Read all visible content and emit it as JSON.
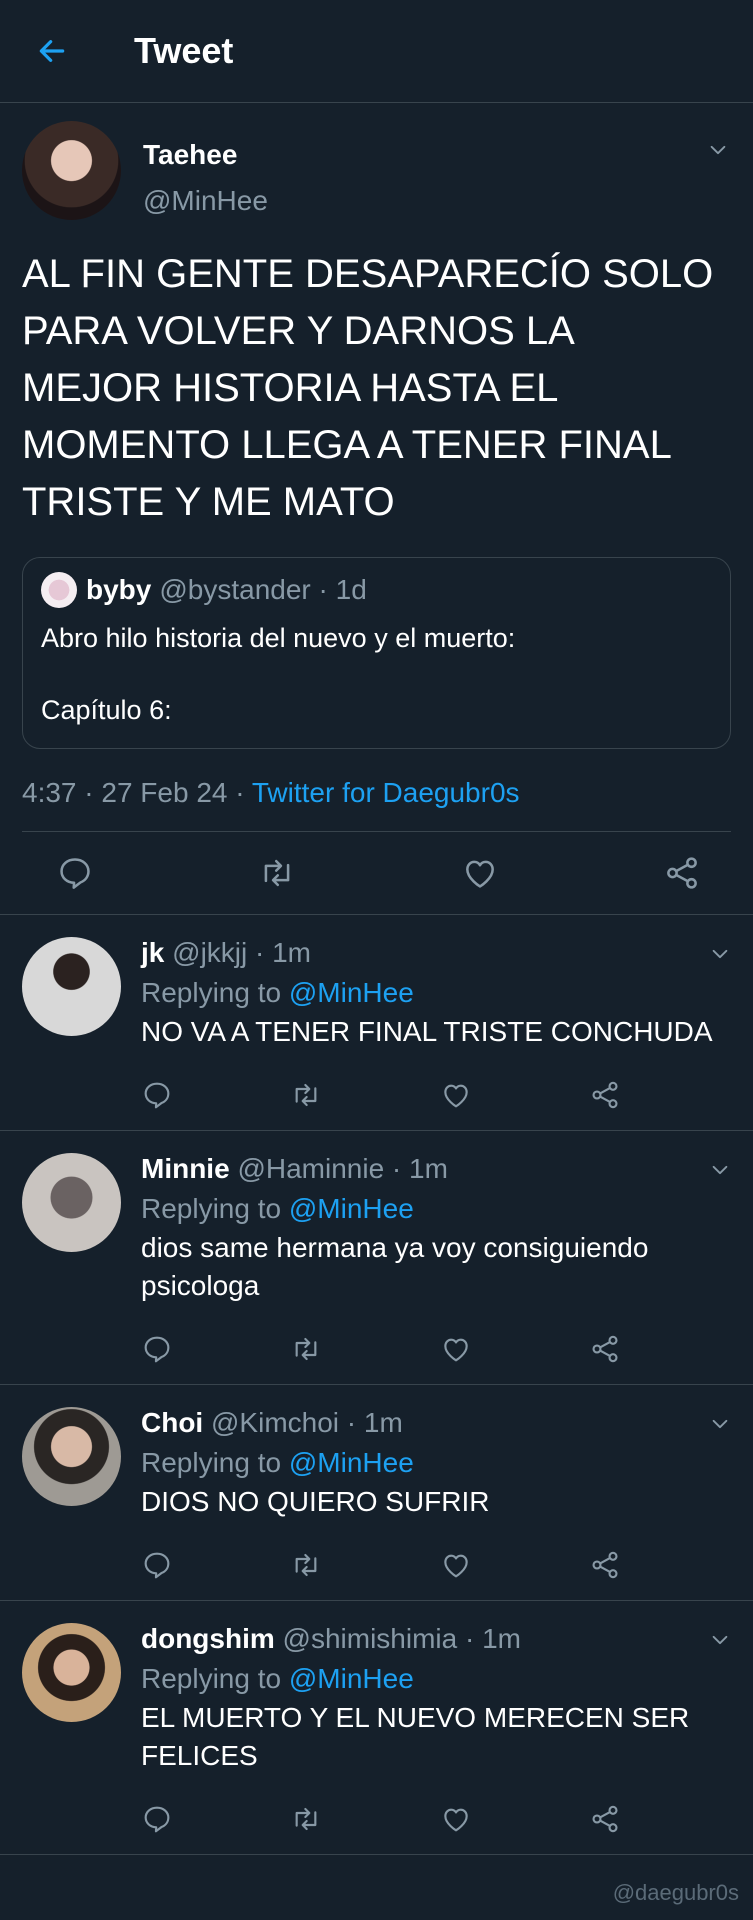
{
  "header": {
    "title": "Tweet"
  },
  "main_tweet": {
    "author_name": "Taehee",
    "author_handle": "@MinHee",
    "text": "AL FIN GENTE DESAPARECÍO SOLO PARA VOLVER Y DARNOS LA MEJOR HISTORIA HASTA EL MOMENTO LLEGA A TENER FINAL TRISTE Y ME MATO",
    "quote": {
      "name": "byby",
      "handle_time": "@bystander · 1d",
      "text": "Abro hilo historia del nuevo y el muerto:\n\nCapítulo 6:"
    },
    "meta_time": "4:37 · 27 Feb 24 · ",
    "meta_source": "Twitter for Daegubr0s"
  },
  "replies": [
    {
      "name": "jk",
      "handle_time": "@jkkjj · 1m",
      "replying_prefix": "Replying to ",
      "replying_to": "@MinHee",
      "text": "NO VA A TENER FINAL TRISTE CONCHUDA"
    },
    {
      "name": "Minnie",
      "handle_time": "@Haminnie · 1m",
      "replying_prefix": "Replying to ",
      "replying_to": "@MinHee",
      "text": "dios same hermana ya voy consiguiendo psicologa"
    },
    {
      "name": "Choi",
      "handle_time": "@Kimchoi · 1m",
      "replying_prefix": "Replying to ",
      "replying_to": "@MinHee",
      "text": "DIOS NO QUIERO SUFRIR"
    },
    {
      "name": "dongshim",
      "handle_time": "@shimishimia · 1m",
      "replying_prefix": "Replying to ",
      "replying_to": "@MinHee",
      "text": "EL MUERTO Y EL NUEVO MERECEN SER FELICES"
    }
  ],
  "watermark": "@daegubr0s",
  "colors": {
    "background": "#15202b",
    "accent": "#1da1f2",
    "muted": "#8899a6",
    "border": "#38444d"
  },
  "icons": [
    "back-arrow-icon",
    "chevron-down-icon",
    "reply-icon",
    "retweet-icon",
    "like-icon",
    "share-icon"
  ]
}
